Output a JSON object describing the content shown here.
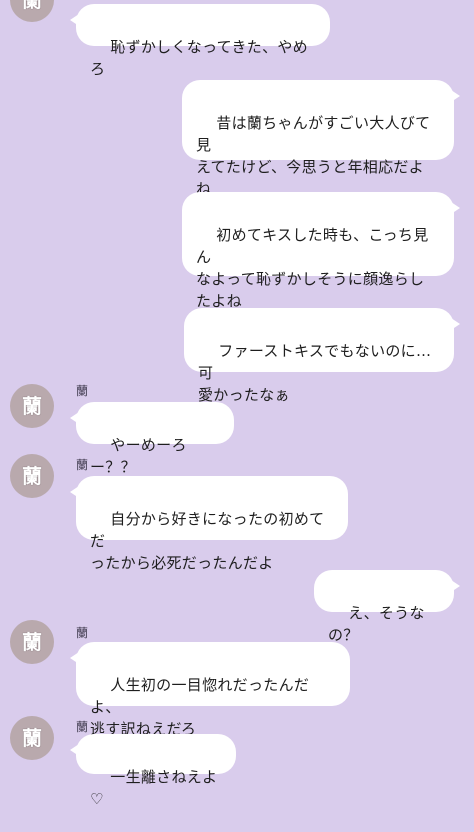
{
  "colors": {
    "background": "#d9ccec",
    "bubble": "#ffffff",
    "avatar": "#b9a9ad",
    "name_text": "#3a3548"
  },
  "messages": [
    {
      "side": "left",
      "sender": "",
      "text": "恥ずかしくなってきた、やめろ"
    },
    {
      "side": "right",
      "text": "昔は蘭ちゃんがすごい大人びて見\nえてたけど、今思うと年相応だよ\nね"
    },
    {
      "side": "right",
      "text": "初めてキスした時も、こっち見ん\nなよって恥ずかしそうに顔逸らし\nたよね"
    },
    {
      "side": "right",
      "text": "ファーストキスでもないのに…可\n愛かったなぁ"
    },
    {
      "side": "left",
      "sender": "蘭",
      "text": "やーめーろー？？"
    },
    {
      "side": "left",
      "sender": "蘭",
      "text": "自分から好きになったの初めてだ\nったから必死だったんだよ"
    },
    {
      "side": "right",
      "text": "え、そうなの？"
    },
    {
      "side": "left",
      "sender": "蘭",
      "text": "人生初の一目惚れだったんだよ、\n逃す訳ねえだろ"
    },
    {
      "side": "left",
      "sender": "蘭",
      "text": "一生離さねえよ♡"
    }
  ],
  "avatar": {
    "glyph": "蘭",
    "icon": "avatar-icon"
  }
}
